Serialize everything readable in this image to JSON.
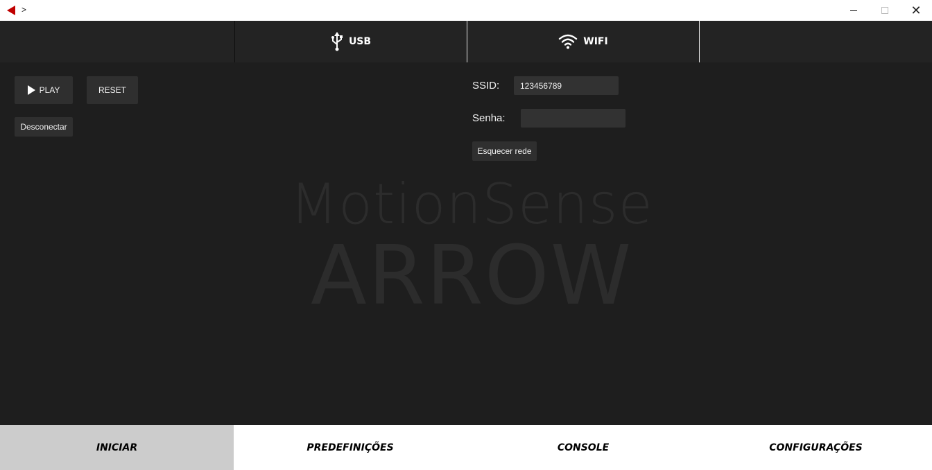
{
  "titlebar": {
    "title": ">",
    "app_icon": "arrow-left-icon",
    "minimize_icon": "minimize-icon",
    "maximize_icon": "maximize-icon",
    "close_icon": "close-icon",
    "close_glyph": "✕"
  },
  "connection_tabs": [
    {
      "label": "USB",
      "icon": "usb-icon"
    },
    {
      "label": "WIFI",
      "icon": "wifi-icon"
    }
  ],
  "controls": {
    "play_label": "PLAY",
    "reset_label": "RESET",
    "disconnect_label": "Desconectar"
  },
  "wifi_form": {
    "ssid_label": "SSID:",
    "ssid_value": "123456789",
    "password_label": "Senha:",
    "password_value": "",
    "forget_label": "Esquecer rede"
  },
  "watermark": {
    "line1": "MotionSense",
    "line2": "ARROW"
  },
  "bottom_nav": {
    "active": "INICIAR",
    "tabs": [
      "INICIAR",
      "PREDEFINIÇÕES",
      "CONSOLE",
      "CONFIGURAÇÕES"
    ]
  },
  "colors": {
    "background": "#1e1e1e",
    "brand_red": "#c00000",
    "active_tab": "#cccccc"
  }
}
